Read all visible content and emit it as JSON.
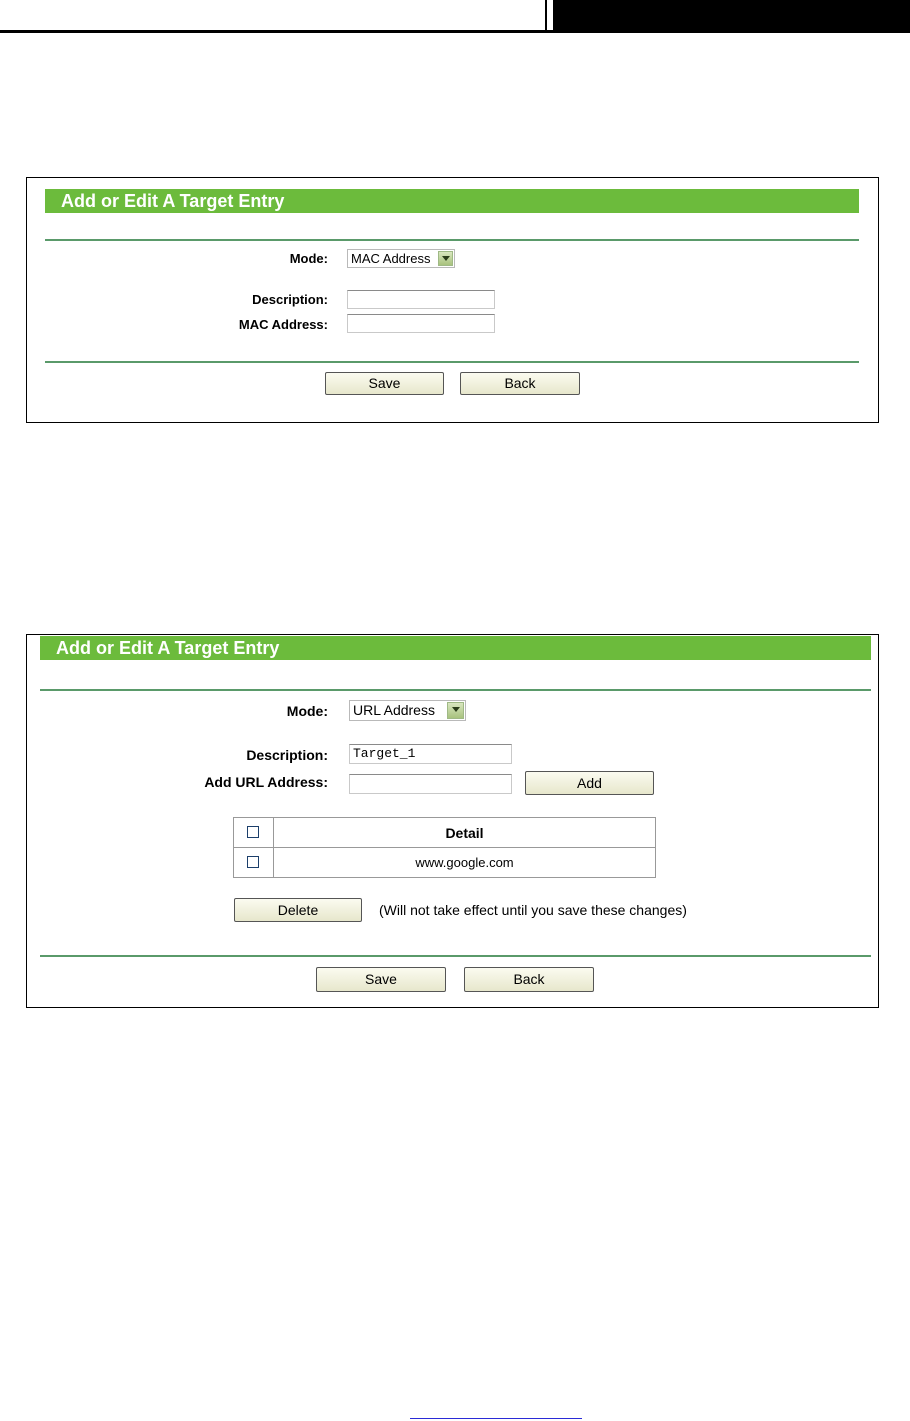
{
  "panel1": {
    "title": "Add or Edit A Target Entry",
    "mode_label": "Mode:",
    "mode_value": "MAC Address",
    "description_label": "Description:",
    "description_value": "",
    "mac_label": "MAC Address:",
    "mac_value": "",
    "save_label": "Save",
    "back_label": "Back"
  },
  "panel2": {
    "title": "Add or Edit A Target Entry",
    "mode_label": "Mode:",
    "mode_value": "URL Address",
    "description_label": "Description:",
    "description_value": "Target_1",
    "url_label": "Add URL Address:",
    "url_value": "",
    "add_label": "Add",
    "table": {
      "header": "Detail",
      "rows": [
        "www.google.com"
      ]
    },
    "delete_label": "Delete",
    "delete_note": "(Will not take effect until you save these changes)",
    "save_label": "Save",
    "back_label": "Back"
  },
  "colors": {
    "title_bar": "#6cbb3c",
    "divider": "#5a9a6a",
    "checkbox_border": "#1c3f6b"
  },
  "icons": {
    "dropdown": "chevron-down-icon"
  }
}
